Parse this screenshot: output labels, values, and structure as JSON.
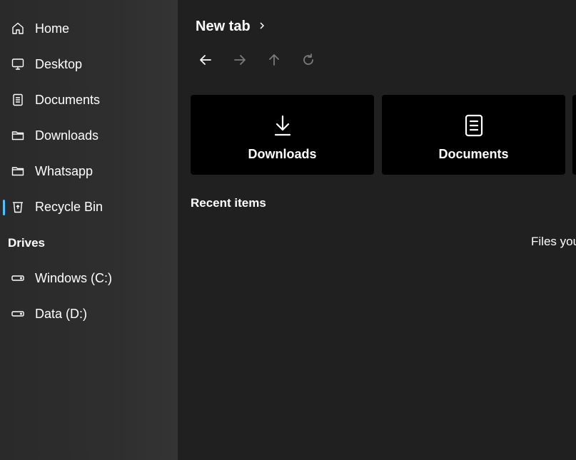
{
  "sidebar": {
    "items": [
      {
        "label": "Home",
        "icon": "home-icon"
      },
      {
        "label": "Desktop",
        "icon": "desktop-icon"
      },
      {
        "label": "Documents",
        "icon": "document-icon"
      },
      {
        "label": "Downloads",
        "icon": "folder-icon"
      },
      {
        "label": "Whatsapp",
        "icon": "folder-icon"
      },
      {
        "label": "Recycle Bin",
        "icon": "recycle-bin-icon",
        "active": true
      }
    ],
    "drives_header": "Drives",
    "drives": [
      {
        "label": "Windows (C:)",
        "icon": "drive-icon"
      },
      {
        "label": "Data (D:)",
        "icon": "drive-icon"
      }
    ]
  },
  "header": {
    "title": "New tab"
  },
  "quick_access": {
    "cards": [
      {
        "label": "Downloads",
        "icon": "download-icon"
      },
      {
        "label": "Documents",
        "icon": "document-icon"
      }
    ]
  },
  "recent": {
    "title": "Recent items",
    "empty_text": "Files you"
  },
  "colors": {
    "accent": "#4cc2ff",
    "background": "#202020",
    "sidebar": "#2c2c2c",
    "card": "#000000"
  }
}
